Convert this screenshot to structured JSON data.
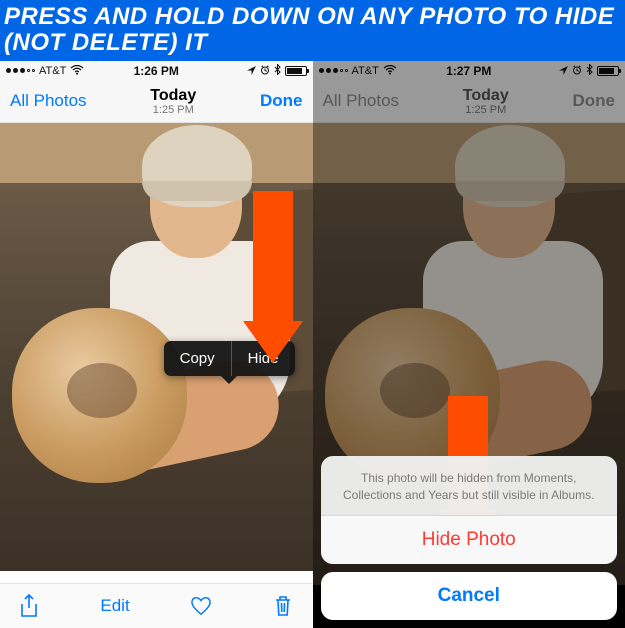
{
  "banner": "PRESS AND HOLD DOWN ON ANY PHOTO TO HIDE (NOT DELETE) IT",
  "left": {
    "status": {
      "carrier": "AT&T",
      "time": "1:26 PM"
    },
    "nav": {
      "back": "All Photos",
      "title": "Today",
      "subtitle": "1:25 PM",
      "done": "Done"
    },
    "popover": {
      "copy": "Copy",
      "hide": "Hide"
    },
    "toolbar": {
      "edit": "Edit"
    }
  },
  "right": {
    "status": {
      "carrier": "AT&T",
      "time": "1:27 PM"
    },
    "nav": {
      "back": "All Photos",
      "title": "Today",
      "subtitle": "1:25 PM",
      "done": "Done"
    },
    "sheet": {
      "message": "This photo will be hidden from Moments, Collections and Years but still visible in Albums.",
      "hide": "Hide Photo",
      "cancel": "Cancel"
    }
  }
}
